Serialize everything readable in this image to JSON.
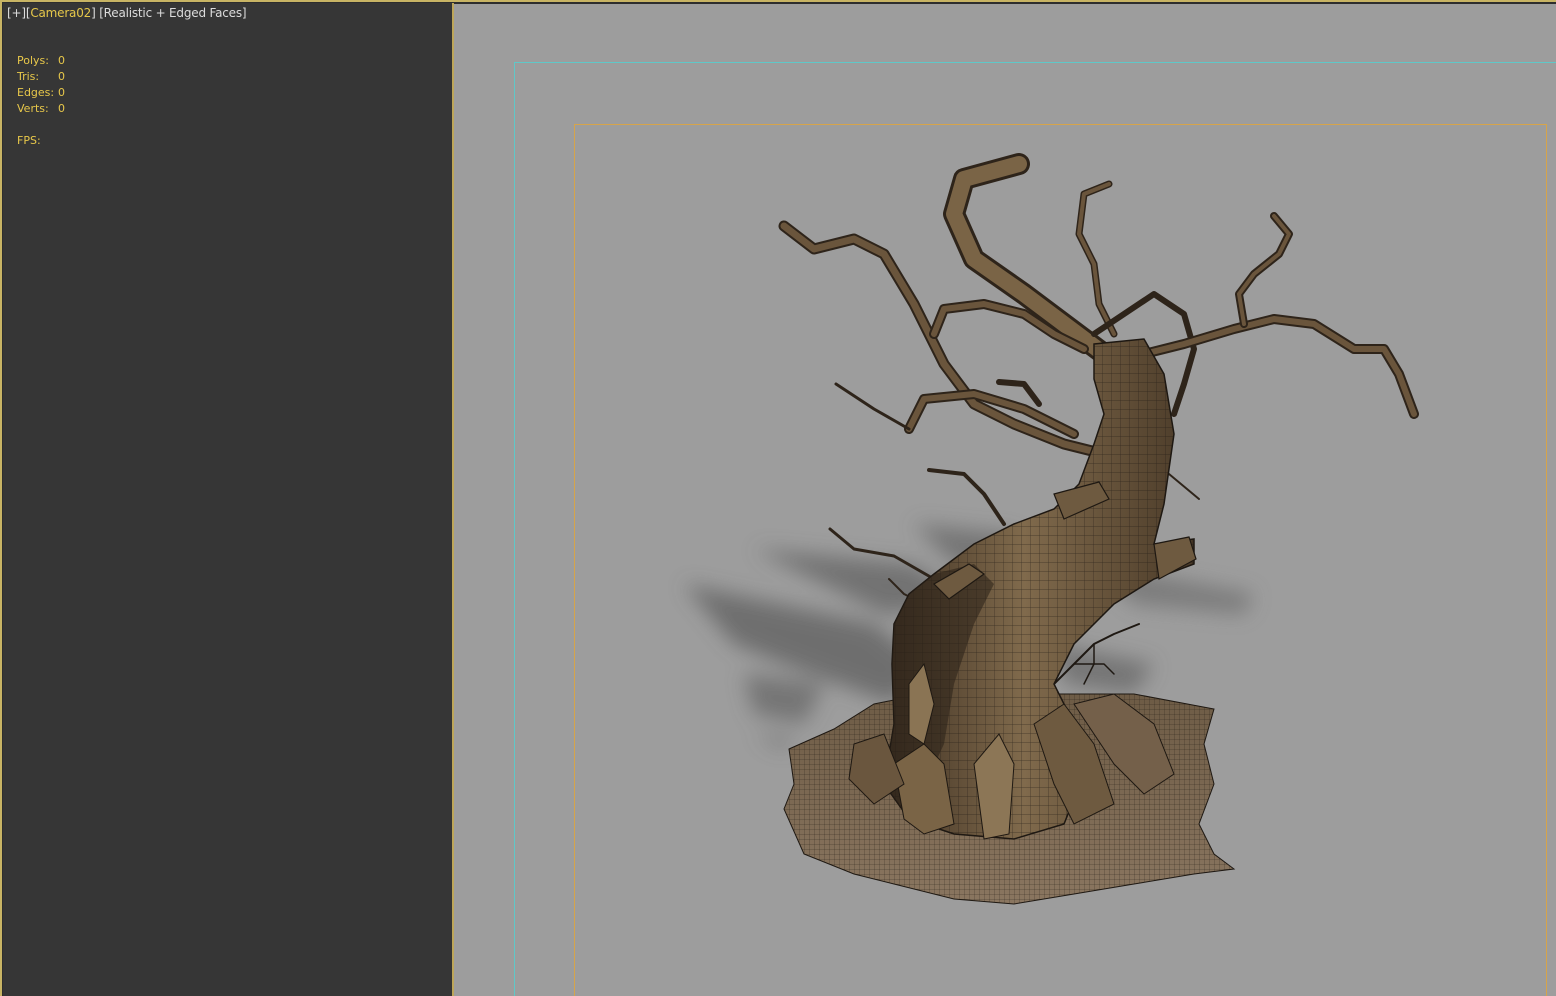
{
  "viewport": {
    "plus_menu": "[+]",
    "camera_name": "Camera02",
    "shading_mode": "Realistic + Edged Faces",
    "bracket_open": "[",
    "bracket_close": "]"
  },
  "stats": {
    "polys_label": "Polys:",
    "polys_value": "0",
    "tris_label": "Tris:",
    "tris_value": "0",
    "edges_label": "Edges:",
    "edges_value": "0",
    "verts_label": "Verts:",
    "verts_value": "0",
    "fps_label": "FPS:",
    "fps_value": ""
  },
  "colors": {
    "viewport_background": "#9d9d9d",
    "left_panel": "#363636",
    "active_border": "#c8b464",
    "stats_text": "#e8c84a",
    "safe_frame_outer": "#5fc8c8",
    "safe_frame_inner": "#d6a44a",
    "bark": "#6e5a40",
    "wireframe": "#1e1812"
  },
  "scene": {
    "object": "dead-tree-model",
    "shading": "realistic-edged-faces"
  }
}
